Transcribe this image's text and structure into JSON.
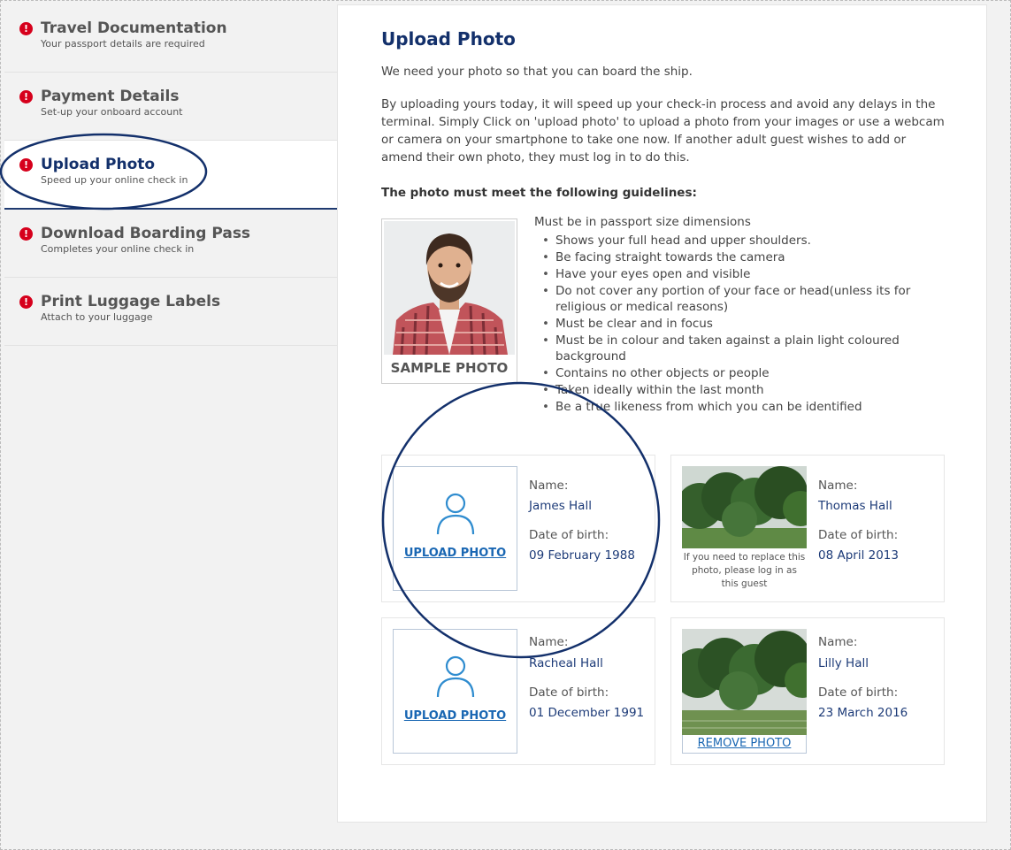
{
  "sidebar": {
    "items": [
      {
        "title": "Travel Documentation",
        "subtitle": "Your passport details are required",
        "active": false
      },
      {
        "title": "Payment Details",
        "subtitle": "Set-up your onboard account",
        "active": false
      },
      {
        "title": "Upload Photo",
        "subtitle": "Speed up your online check in",
        "active": true
      },
      {
        "title": "Download Boarding Pass",
        "subtitle": "Completes your online check in",
        "active": false
      },
      {
        "title": "Print Luggage Labels",
        "subtitle": "Attach to your luggage",
        "active": false
      }
    ],
    "alert_glyph": "!"
  },
  "main": {
    "title": "Upload Photo",
    "intro": "We need your photo so that you can board the ship.",
    "description": "By uploading yours today, it will speed up your check-in process and avoid any delays in the terminal. Simply Click on 'upload photo' to upload a photo from your images or use a webcam or camera on your smartphone to take one now. If another adult guest wishes to add or amend their own photo, they must log in to do this.",
    "guidelines_heading": "The photo must meet the following guidelines:",
    "sample_label": "SAMPLE PHOTO",
    "rules_intro": "Must be in passport size dimensions",
    "rules": [
      "Shows your full head and upper shoulders.",
      "Be facing straight towards the camera",
      "Have your eyes open and visible",
      "Do not cover any portion of your face or head(unless its for religious or medical reasons)",
      "Must be clear and in focus",
      "Must be in colour and taken against a plain light coloured background",
      "Contains no other objects or people",
      "Taken ideally within the last month",
      "Be a true likeness from which you can be identified"
    ]
  },
  "guests": {
    "name_label": "Name:",
    "dob_label": "Date of birth:",
    "upload_label": "UPLOAD PHOTO",
    "remove_label": "REMOVE PHOTO",
    "replace_note": "If you need to replace this photo, please log in as this guest",
    "list": [
      {
        "name": "James Hall",
        "dob": "09 February 1988"
      },
      {
        "name": "Thomas Hall",
        "dob": "08 April 2013"
      },
      {
        "name": "Racheal Hall",
        "dob": "01 December 1991"
      },
      {
        "name": "Lilly Hall",
        "dob": "23 March 2016"
      }
    ]
  },
  "colors": {
    "brand_navy": "#13306b",
    "alert_red": "#d6001c",
    "link_blue": "#1a67b3"
  }
}
